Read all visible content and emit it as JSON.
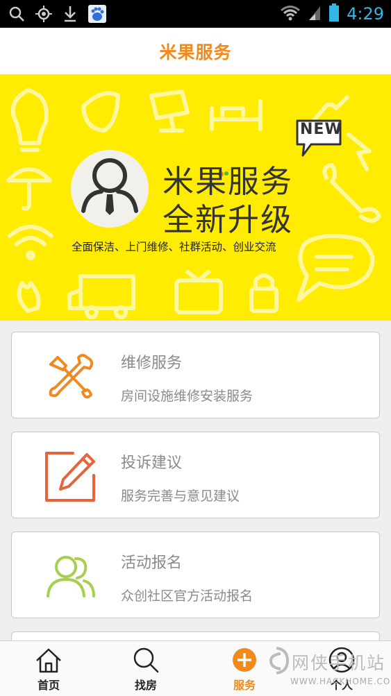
{
  "status_bar": {
    "time": "4:29",
    "icons": [
      "search-icon",
      "location-icon",
      "download-icon",
      "baidu-icon",
      "wifi-icon",
      "signal-icon",
      "battery-icon"
    ]
  },
  "header": {
    "title": "米果服务"
  },
  "banner": {
    "title_line1": "米果服务",
    "title_line2": "全新升级",
    "subtitle": "全面保洁、上门维修、社群活动、创业交流",
    "badge": "NEW",
    "background_color": "#ffec00"
  },
  "services": [
    {
      "title": "维修服务",
      "desc": "房间设施维修安装服务",
      "icon": "wrench-screwdriver-icon",
      "color": "#f08a1c"
    },
    {
      "title": "投诉建议",
      "desc": "服务完善与意见建议",
      "icon": "edit-icon",
      "color": "#e8623a"
    },
    {
      "title": "活动报名",
      "desc": "众创社区官方活动报名",
      "icon": "people-icon",
      "color": "#a6cf4e"
    }
  ],
  "tabs": [
    {
      "label": "首页",
      "icon": "home-icon"
    },
    {
      "label": "找房",
      "icon": "search-icon"
    },
    {
      "label": "服务",
      "icon": "plus-icon",
      "active": true
    },
    {
      "label": "个人",
      "icon": "user-icon"
    }
  ],
  "watermark": {
    "line1": "网侠手机站",
    "line2": "WWW.HACKHOME.COM"
  },
  "colors": {
    "accent": "#f08a1c",
    "text_gray": "#8a8a8a"
  }
}
